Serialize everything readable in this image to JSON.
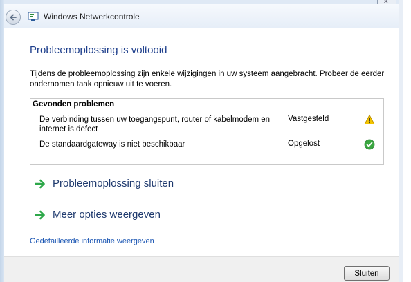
{
  "window": {
    "title": "Windows Netwerkcontrole"
  },
  "main": {
    "heading": "Probleemoplossing is voltooid",
    "intro": "Tijdens de probleemoplossing zijn enkele wijzigingen in uw systeem aangebracht. Probeer de eerder ondernomen taak opnieuw uit te voeren.",
    "problems": {
      "header": "Gevonden problemen",
      "items": [
        {
          "description": "De verbinding tussen uw toegangspunt, router of kabelmodem en internet is defect",
          "status": "Vastgesteld",
          "icon": "warning-icon"
        },
        {
          "description": "De standaardgateway is niet beschikbaar",
          "status": "Opgelost",
          "icon": "checkmark-icon"
        }
      ]
    },
    "actions": {
      "close_troubleshooting": "Probleemoplossing sluiten",
      "more_options": "Meer opties weergeven"
    },
    "detail_link": "Gedetailleerde informatie weergeven"
  },
  "footer": {
    "close_label": "Sluiten"
  },
  "colors": {
    "heading": "#1e3f8c",
    "link": "#1b56b3",
    "arrow": "#2ea84a",
    "warning": "#f3c400",
    "ok": "#3aa640"
  }
}
